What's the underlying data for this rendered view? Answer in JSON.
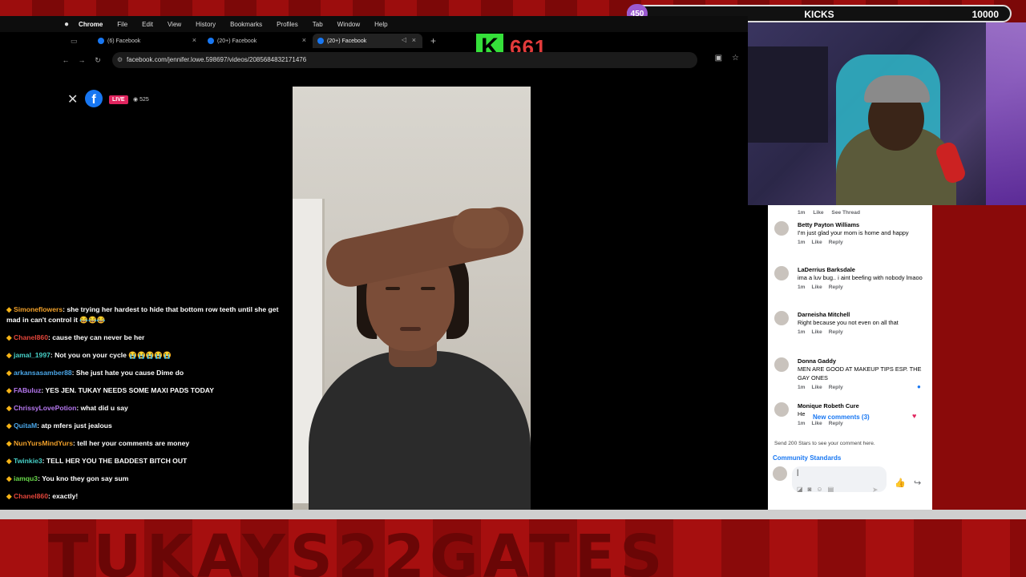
{
  "kicks": {
    "current": "450",
    "label": "KICKS",
    "goal": "10000"
  },
  "menubar": {
    "app": "Chrome",
    "items": [
      "File",
      "Edit",
      "View",
      "History",
      "Bookmarks",
      "Profiles",
      "Tab",
      "Window",
      "Help"
    ]
  },
  "tabs": [
    {
      "title": "(6) Facebook"
    },
    {
      "title": "(20+) Facebook"
    },
    {
      "title": "(20+) Facebook"
    }
  ],
  "kick_overlay": {
    "logo": "K",
    "count": "661"
  },
  "address": {
    "url": "facebook.com/jennifer.lowe.598697/videos/2085684832171476"
  },
  "fb": {
    "logo": "f",
    "live": "LIVE",
    "viewers": "525"
  },
  "chat": [
    {
      "user": "Simoneflowers",
      "color": "u-orange",
      "text": "she trying her hardest to hide that bottom row teeth until she get mad in can't control it 😂😂😂"
    },
    {
      "user": "Chanel860",
      "color": "u-red",
      "text": "cause they can never be her"
    },
    {
      "user": "jamal_1997",
      "color": "u-cyan",
      "text": "Not you on your cycle 😭😭😭😭😭"
    },
    {
      "user": "arkansasamber88",
      "color": "u-blue",
      "text": "She just hate you cause Dime do"
    },
    {
      "user": "FABuluz",
      "color": "u-purple",
      "text": "YES JEN. TUKAY NEEDS SOME MAXI PADS TODAY"
    },
    {
      "user": "ChrissyLovePotion",
      "color": "u-purple",
      "text": "what did u say"
    },
    {
      "user": "QuitaM",
      "color": "u-blue",
      "text": "atp mfers just jealous"
    },
    {
      "user": "NunYursMindYurs",
      "color": "u-orange",
      "text": "tell her your comments are money"
    },
    {
      "user": "Twinkie3",
      "color": "u-cyan",
      "text": "TELL HER YOU THE BADDEST BITCH OUT"
    },
    {
      "user": "iamqu3",
      "color": "u-green",
      "text": "You kno they gon say sum"
    },
    {
      "user": "Chanel860",
      "color": "u-red",
      "text": "exactly!"
    }
  ],
  "comments": {
    "top_meta": {
      "time": "1m",
      "like": "Like",
      "thread": "See Thread"
    },
    "items": [
      {
        "name": "Betty Payton Williams",
        "text": "I'm just glad your mom is home and happy",
        "time": "1m",
        "like": "Like",
        "reply": "Reply"
      },
      {
        "name": "LaDerrius Barksdale",
        "text": "ima a luv bug.. i aint beefing with nobody lmaoo",
        "time": "1m",
        "like": "Like",
        "reply": "Reply"
      },
      {
        "name": "Darneisha Mitchell",
        "text": "Right because you not even on all that",
        "time": "1m",
        "like": "Like",
        "reply": "Reply"
      },
      {
        "name": "Donna Gaddy",
        "text": "MEN ARE GOOD AT MAKEUP TIPS ESP. THE GAY ONES",
        "time": "1m",
        "like": "Like",
        "reply": "Reply"
      },
      {
        "name": "Monique Robeth Cure",
        "text": "He",
        "time": "1m",
        "like": "Like",
        "reply": "Reply"
      }
    ],
    "new_comments": "New comments (3)",
    "stars": "Send 200 Stars to see your comment here.",
    "standards": "Community Standards",
    "input_value": "|"
  },
  "bottom_banner": "TUKAYS22GATES"
}
